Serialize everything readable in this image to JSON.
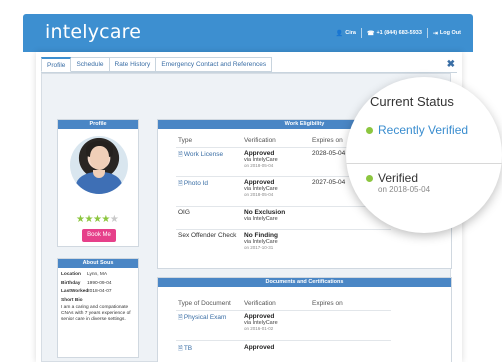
{
  "brand": {
    "logo": "intelycare",
    "primary_color": "#3d8fd0",
    "accent_green": "#8cc63f",
    "accent_pink": "#e6408a"
  },
  "topnav": {
    "user": "Cira",
    "phone": "+1 (844) 683-5933",
    "logout": "Log Out"
  },
  "tabs": [
    "Profile",
    "Schedule",
    "Rate History",
    "Emergency Contact and References"
  ],
  "profile": {
    "header": "Profile",
    "rating": 4,
    "rating_max": 5,
    "book_label": "Book Me"
  },
  "about": {
    "header": "About Sous",
    "rows": [
      {
        "k": "Location",
        "v": "Lynn, MA"
      },
      {
        "k": "Birthday",
        "v": "1990-09-04"
      },
      {
        "k": "LastWorked",
        "v": "2018-04-07"
      }
    ],
    "bio_label": "Short Bio",
    "bio": "I am a caring and compationate CNAs with 7 years experience of senior care in diverse settings."
  },
  "work": {
    "header": "Work Eligibility",
    "columns": [
      "Type",
      "Verification",
      "Expires on"
    ],
    "rows": [
      {
        "type": "Work License",
        "status": "Approved",
        "via": "via IntelyCare",
        "date": "on 2018-05-04",
        "expires": "2028-05-04"
      },
      {
        "type": "Photo Id",
        "status": "Approved",
        "via": "via IntelyCare",
        "date": "on 2018-05-04",
        "expires": "2027-05-04"
      },
      {
        "type": "OIG",
        "status": "No Exclusion",
        "via": "via IntelyCare",
        "date": "",
        "expires": ""
      },
      {
        "type": "Sex Offender Check",
        "status": "No Finding",
        "via": "via IntelyCare",
        "date": "on 2017-10-31",
        "expires": ""
      }
    ],
    "side_status": "Verified",
    "side_date": "on 2017-10-31"
  },
  "docs": {
    "header": "Documents and Certifications",
    "columns": [
      "Type of Document",
      "Verification",
      "Expires on"
    ],
    "rows": [
      {
        "type": "Physical Exam",
        "status": "Approved",
        "via": "via IntelyCare",
        "date": "on 2016-01-02"
      },
      {
        "type": "TB",
        "status": "Approved"
      }
    ]
  },
  "magnifier": {
    "title": "Current Status",
    "recent": "Recently Verified",
    "verified": "Verified",
    "date": "on 2018-05-04"
  }
}
